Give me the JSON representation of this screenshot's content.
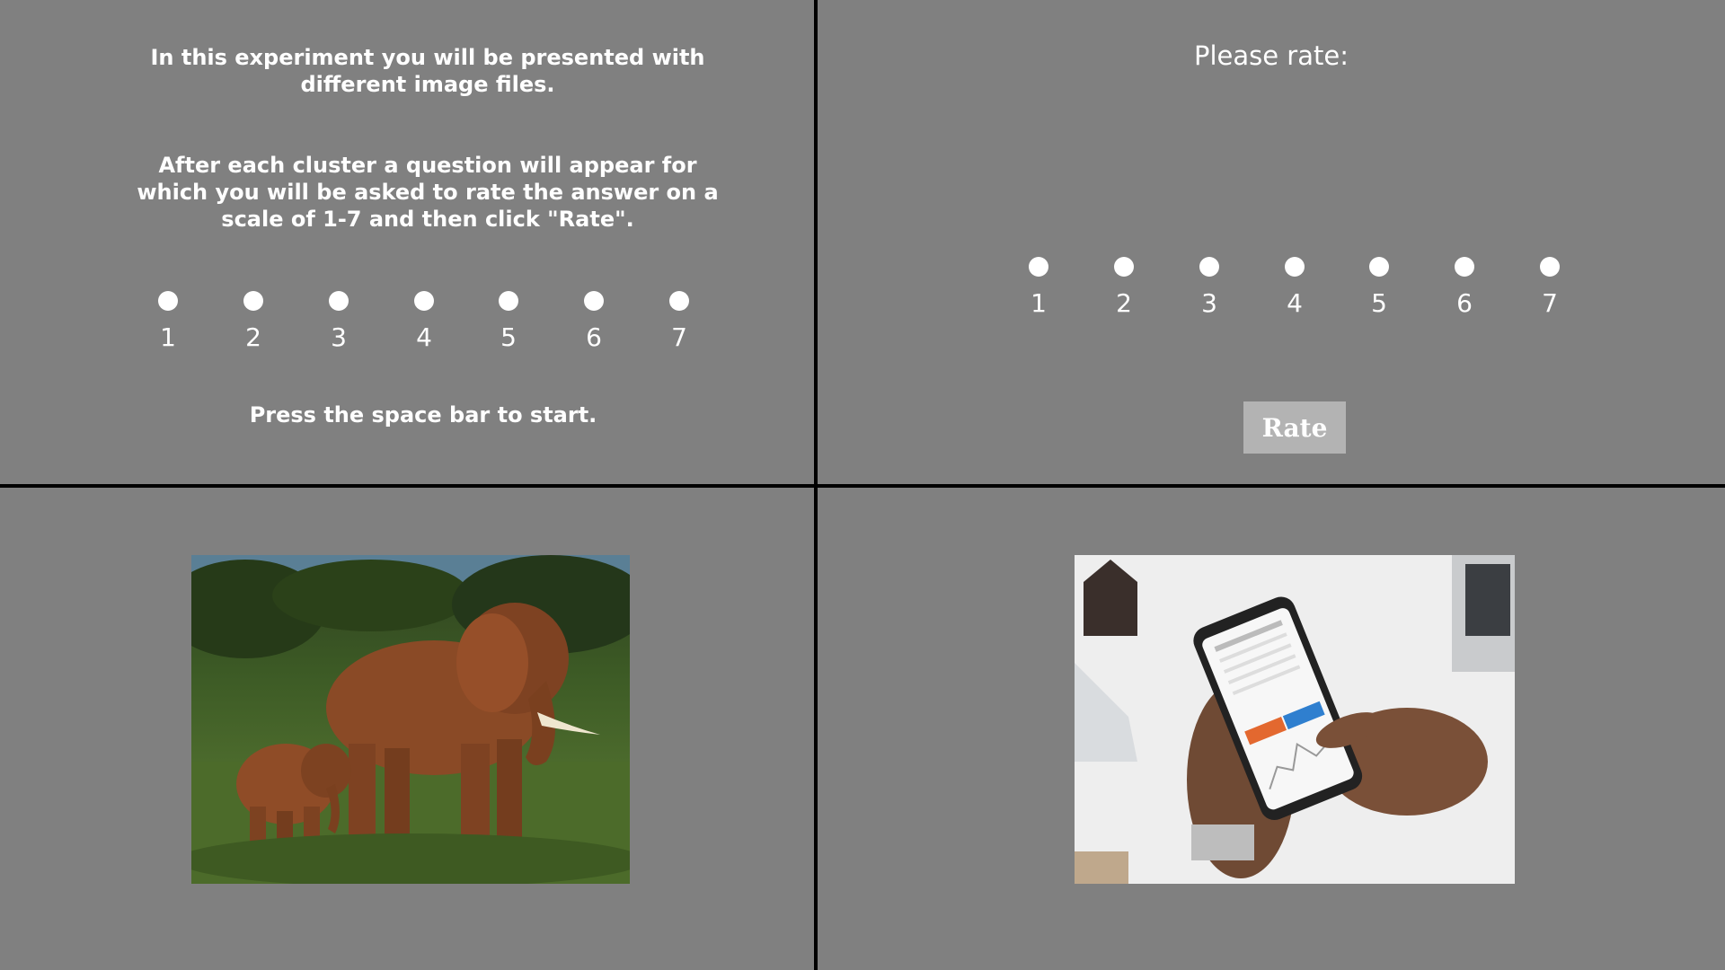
{
  "instructions": {
    "paragraph_1": "In this experiment you will be presented with different image files.",
    "paragraph_2": "After each cluster a question will appear for which you will be asked to rate the answer on a scale of 1-7 and then click \"Rate\".",
    "start_hint": "Press the space bar to start."
  },
  "rating": {
    "prompt": "Please rate:",
    "options": [
      "1",
      "2",
      "3",
      "4",
      "5",
      "6",
      "7"
    ],
    "button_label": "Rate"
  },
  "images": {
    "stimulus_1": "elephant-photo",
    "stimulus_2": "smartphone-trading-app-photo"
  },
  "colors": {
    "background": "#808080",
    "divider": "#000000",
    "button": "#b3b3b3",
    "text": "#ffffff"
  }
}
